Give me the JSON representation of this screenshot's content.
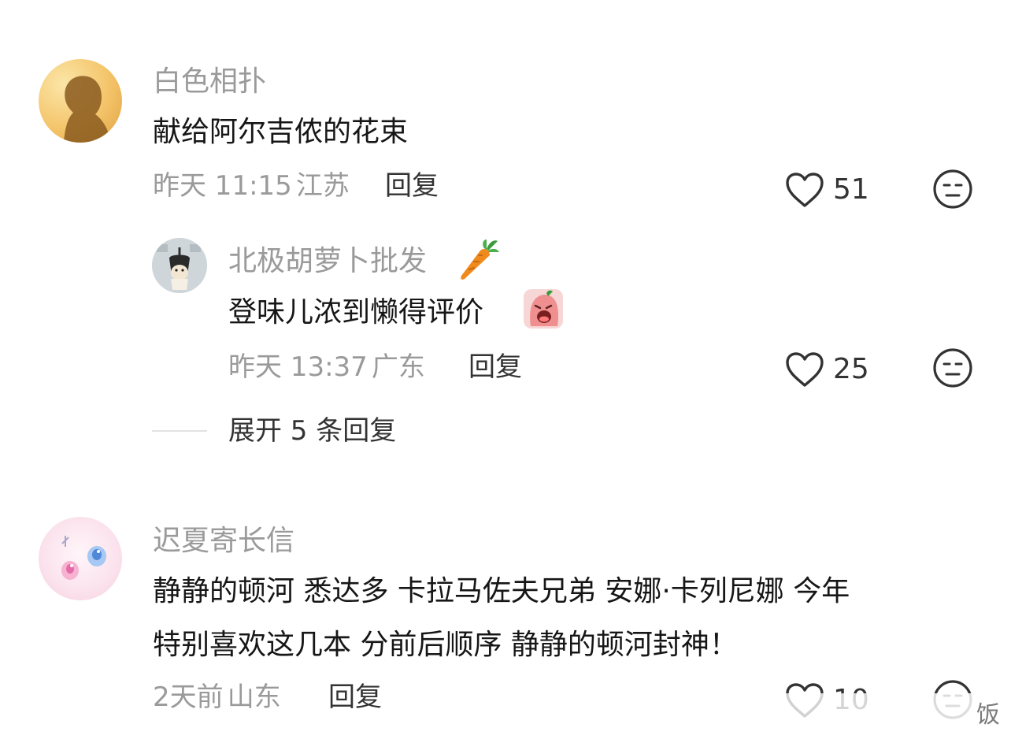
{
  "comments": [
    {
      "username": "白色相扑",
      "text_lines": [
        "献给阿尔吉侬的花束"
      ],
      "time": "昨天 11:15",
      "location": "江苏",
      "reply_label": "回复",
      "likes": "51"
    },
    {
      "username": "迟夏寄长信",
      "text_lines": [
        "静静的顿河 悉达多 卡拉马佐夫兄弟 安娜·卡列尼娜 今年",
        "特别喜欢这几本 分前后顺序 静静的顿河封神！"
      ],
      "time": "2天前",
      "location": "山东",
      "reply_label": "回复",
      "likes": "10"
    }
  ],
  "sub_reply": {
    "username": "北极胡萝卜批发",
    "text": "登味儿浓到懒得评价",
    "time": "昨天 13:37",
    "location": "广东",
    "reply_label": "回复",
    "likes": "25"
  },
  "expand_label": "展开 5 条回复",
  "watermark": "饭"
}
